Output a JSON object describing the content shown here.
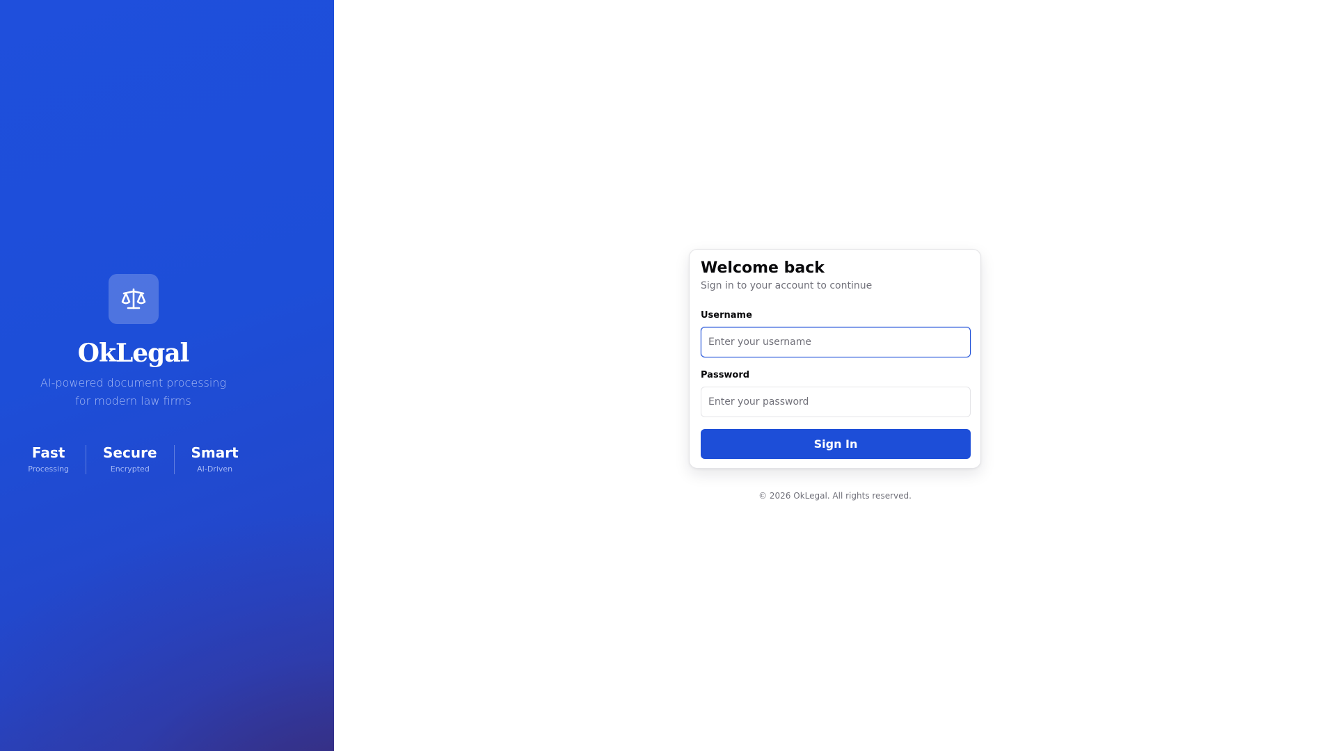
{
  "brand": {
    "name": "OkLegal",
    "tagline_line1": "AI-powered document processing",
    "tagline_line2": "for modern law firms",
    "logo_icon": "scale-icon",
    "features": [
      {
        "title": "Fast",
        "subtitle": "Processing"
      },
      {
        "title": "Secure",
        "subtitle": "Encrypted"
      },
      {
        "title": "Smart",
        "subtitle": "AI-Driven"
      }
    ]
  },
  "login": {
    "title": "Welcome back",
    "subtitle": "Sign in to your account to continue",
    "username_label": "Username",
    "username_placeholder": "Enter your username",
    "username_value": "",
    "password_label": "Password",
    "password_placeholder": "Enter your password",
    "password_value": "",
    "submit_label": "Sign In"
  },
  "footer": {
    "copyright": "© 2026 OkLegal. All rights reserved."
  },
  "colors": {
    "accent": "#1d4ed8",
    "panel_dark": "#3a286e",
    "text_primary": "#09090b",
    "text_muted": "#71717a",
    "border": "#e4e4e7"
  }
}
